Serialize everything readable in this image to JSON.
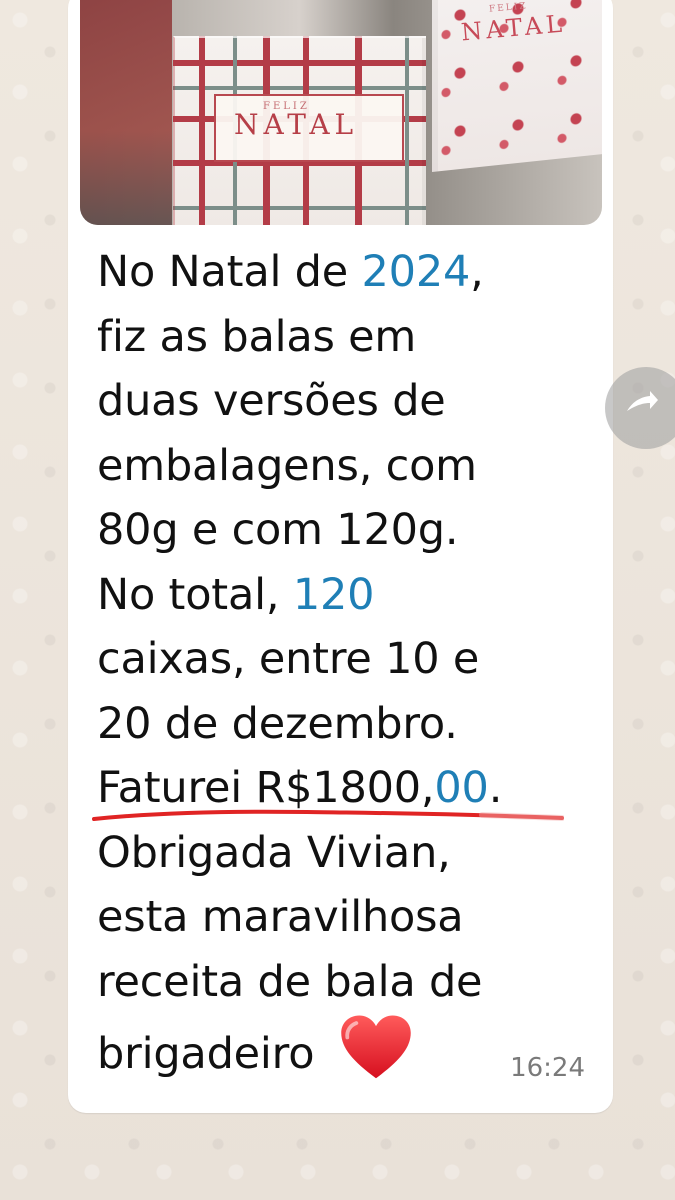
{
  "chat": {
    "image": {
      "box_main_small": "FELIZ",
      "box_main_word": "NATAL",
      "box_right_small": "FELIZ",
      "box_right_word": "NATAL"
    },
    "message": {
      "line1_prefix": "No Natal de ",
      "line1_year": "2024",
      "line1_suffix": ",",
      "line2": "fiz as balas em",
      "line3": "duas versões de",
      "line4": "embalagens, com",
      "line5": "80g e com 120g.",
      "line6_prefix": "No total, ",
      "line6_value": "120",
      "line7": "caixas, entre 10 e",
      "line8": "20 de dezembro.",
      "line9_prefix": "Faturei R$1800,",
      "line9_cents": "00",
      "line9_suffix": ".",
      "line10": "Obrigada Vivian,",
      "line11": "esta maravilhosa",
      "line12": "receita de bala de",
      "line13": "brigadeiro"
    },
    "time": "16:24",
    "icons": {
      "heart": "heart-emoji-icon",
      "forward": "forward-icon"
    },
    "colors": {
      "background": "#ece5dd",
      "bubble": "#ffffff",
      "accent": "#1f7fb6",
      "underline": "#e02424",
      "timestamp": "#7a7a7a"
    }
  }
}
